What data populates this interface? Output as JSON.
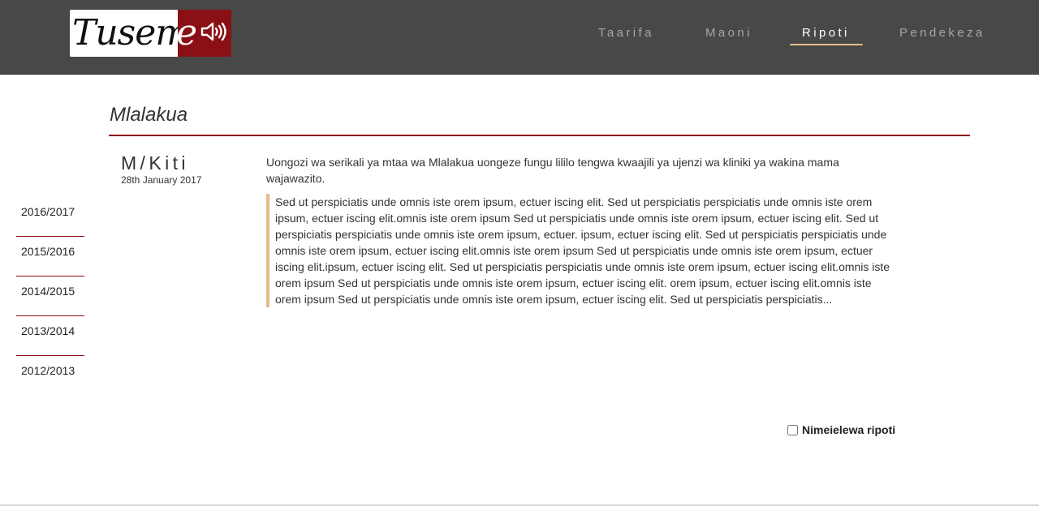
{
  "brand": {
    "logo_text_main": "Tusem",
    "logo_text_accent": "e",
    "logo_icon": "speaker-icon"
  },
  "nav": {
    "items": [
      {
        "label": "Taarifa",
        "active": false
      },
      {
        "label": "Maoni",
        "active": false
      },
      {
        "label": "Ripoti",
        "active": true
      },
      {
        "label": "Pendekeza",
        "active": false
      }
    ]
  },
  "section": {
    "title": "Mlalakua"
  },
  "sidebar": {
    "years": [
      "2016/2017",
      "2015/2016",
      "2014/2015",
      "2013/2014",
      "2012/2013"
    ]
  },
  "report": {
    "author": "M/Kiti",
    "date": "28th January 2017",
    "summary": "Uongozi wa serikali ya mtaa wa Mlalakua uongeze fungu lililo tengwa kwaajili ya ujenzi wa kliniki ya wakina mama wajawazito.",
    "body": "Sed ut perspiciatis unde omnis iste orem ipsum, ectuer iscing elit. Sed ut perspiciatis perspiciatis unde omnis iste orem ipsum, ectuer iscing elit.omnis iste orem ipsum Sed ut perspiciatis unde omnis iste orem ipsum, ectuer iscing elit. Sed ut perspiciatis perspiciatis unde omnis iste orem ipsum, ectuer. ipsum, ectuer iscing elit. Sed ut perspiciatis perspiciatis unde omnis iste orem ipsum, ectuer iscing elit.omnis iste orem ipsum Sed ut perspiciatis unde omnis iste orem ipsum, ectuer iscing elit.ipsum, ectuer iscing elit. Sed ut perspiciatis perspiciatis unde omnis iste orem ipsum, ectuer iscing elit.omnis iste orem ipsum Sed ut perspiciatis unde omnis iste orem ipsum, ectuer iscing elit. orem ipsum, ectuer iscing elit.omnis iste orem ipsum Sed ut perspiciatis unde omnis iste orem ipsum, ectuer iscing elit. Sed ut perspiciatis perspiciatis..."
  },
  "confirm": {
    "label": "Nimeielewa ripoti",
    "checked": false
  },
  "colors": {
    "header_bg": "#484848",
    "brand_red": "#8b1016",
    "accent_gold": "#e2bd88"
  }
}
